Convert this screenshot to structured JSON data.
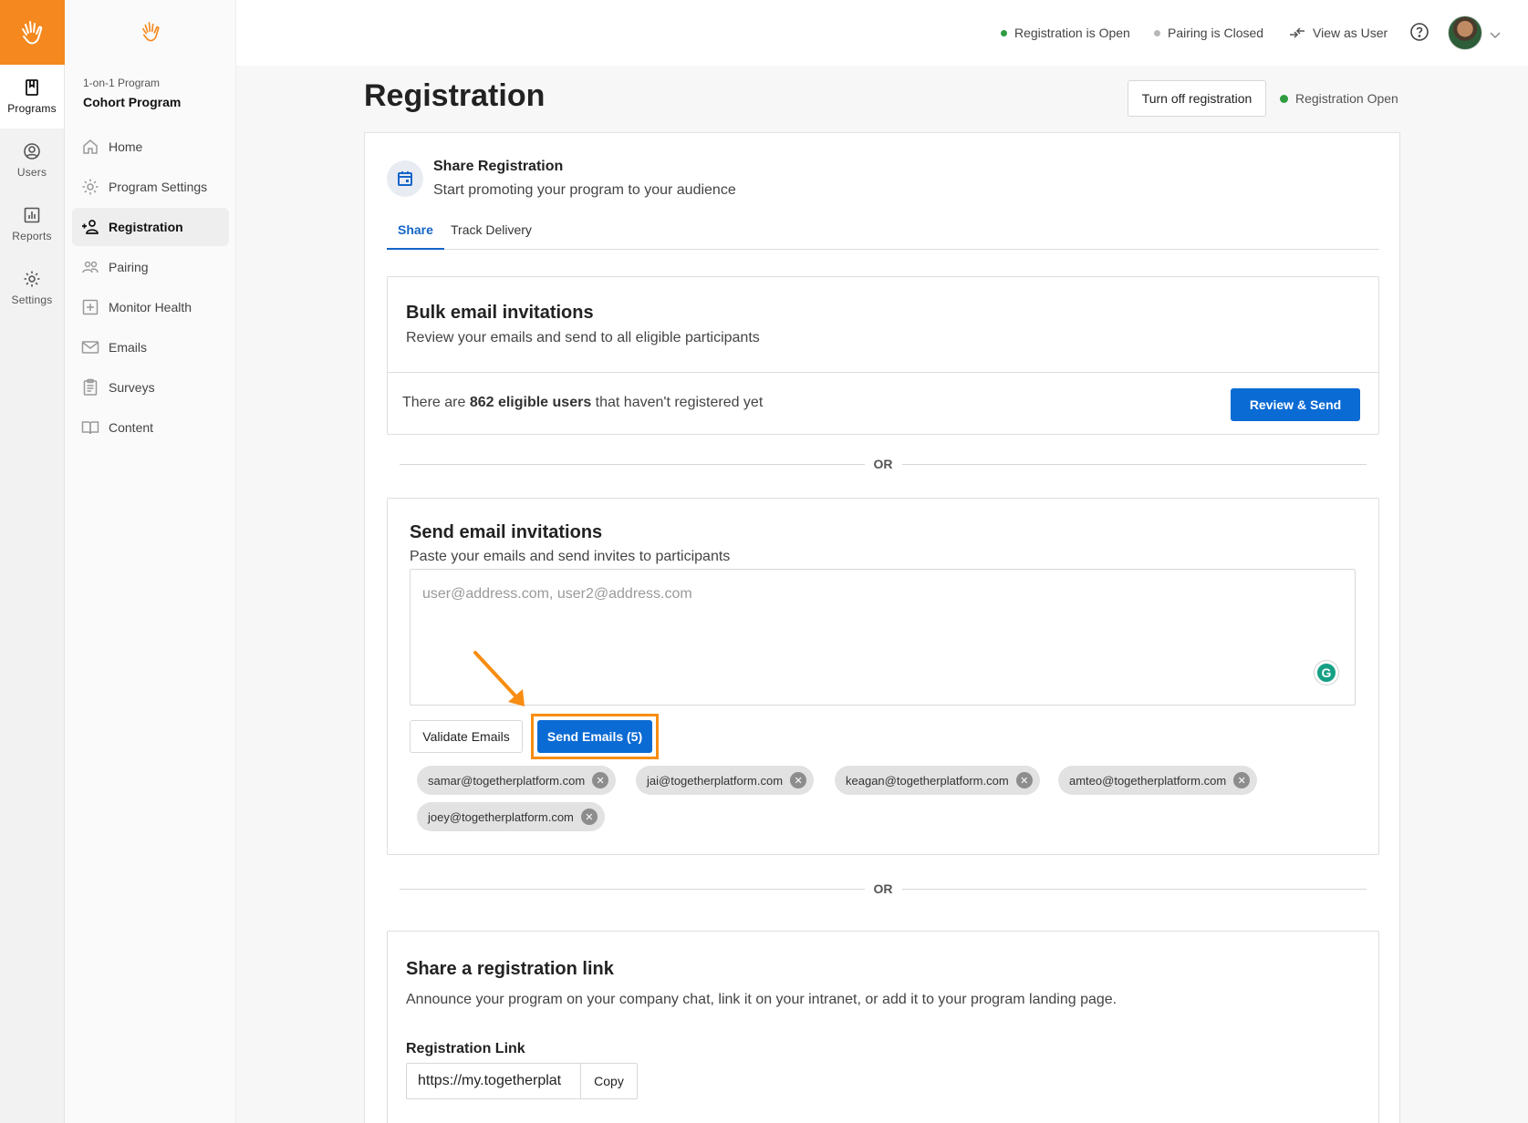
{
  "rail": {
    "items": [
      {
        "label": "Programs",
        "icon": "book-icon"
      },
      {
        "label": "Users",
        "icon": "user-circle-icon"
      },
      {
        "label": "Reports",
        "icon": "bar-chart-icon"
      },
      {
        "label": "Settings",
        "icon": "gear-icon"
      }
    ]
  },
  "sidebar": {
    "program_type": "1-on-1 Program",
    "program_name": "Cohort Program",
    "items": [
      {
        "label": "Home",
        "icon": "home-icon"
      },
      {
        "label": "Program Settings",
        "icon": "gear-icon"
      },
      {
        "label": "Registration",
        "icon": "add-user-icon"
      },
      {
        "label": "Pairing",
        "icon": "users-icon"
      },
      {
        "label": "Monitor Health",
        "icon": "plus-square-icon"
      },
      {
        "label": "Emails",
        "icon": "mail-icon"
      },
      {
        "label": "Surveys",
        "icon": "clipboard-icon"
      },
      {
        "label": "Content",
        "icon": "book-open-icon"
      }
    ]
  },
  "topbar": {
    "registration_status": "Registration is Open",
    "pairing_status": "Pairing is Closed",
    "view_as_user": "View as User"
  },
  "header": {
    "title": "Registration",
    "turn_off_label": "Turn off registration",
    "status_label": "Registration Open"
  },
  "share": {
    "title": "Share Registration",
    "subtitle": "Start promoting your program to your audience",
    "tabs": [
      {
        "label": "Share"
      },
      {
        "label": "Track Delivery"
      }
    ]
  },
  "bulk": {
    "title": "Bulk email invitations",
    "subtitle": "Review your emails and send to all eligible participants",
    "text_prefix": "There are ",
    "count_text": "862 eligible users",
    "text_suffix": " that haven't registered yet",
    "button_label": "Review & Send"
  },
  "or_label": "OR",
  "send": {
    "title": "Send email invitations",
    "subtitle": "Paste your emails and send invites to participants",
    "placeholder": "user@address.com, user2@address.com",
    "validate_label": "Validate Emails",
    "send_label": "Send Emails (5)",
    "chips": [
      {
        "email": "samar@togetherplatform.com"
      },
      {
        "email": "jai@togetherplatform.com"
      },
      {
        "email": "keagan@togetherplatform.com"
      },
      {
        "email": "amteo@togetherplatform.com"
      },
      {
        "email": "joey@togetherplatform.com"
      }
    ]
  },
  "link": {
    "title": "Share a registration link",
    "subtitle": "Announce your program on your company chat, link it on your intranet, or add it to your program landing page.",
    "label": "Registration Link",
    "value": "https://my.togetherplat",
    "copy_label": "Copy"
  },
  "colors": {
    "brand": "#f5891f",
    "primary": "#0b6bd4",
    "status_open": "#2e9c3f",
    "status_closed": "#b8b8b8",
    "highlight": "#f78d12"
  }
}
